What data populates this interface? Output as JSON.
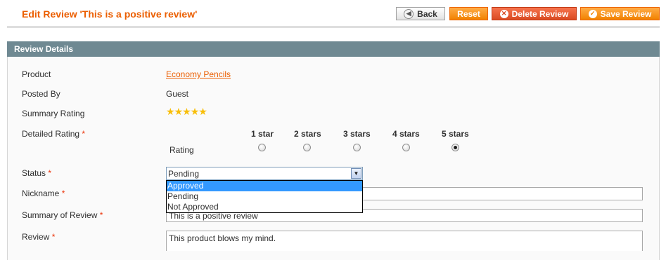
{
  "header": {
    "title": "Edit Review 'This is a positive review'",
    "buttons": {
      "back": "Back",
      "reset": "Reset",
      "delete": "Delete Review",
      "save": "Save Review"
    }
  },
  "section": {
    "title": "Review Details"
  },
  "form": {
    "product": {
      "label": "Product",
      "value": "Economy Pencils"
    },
    "posted_by": {
      "label": "Posted By",
      "value": "Guest"
    },
    "summary_rating": {
      "label": "Summary Rating",
      "stars": 5
    },
    "detailed_rating": {
      "label": "Detailed Rating",
      "required_mark": "*",
      "row_label": "Rating",
      "columns": [
        "1 star",
        "2 stars",
        "3 stars",
        "4 stars",
        "5 stars"
      ],
      "selected_index": 4
    },
    "status": {
      "label": "Status",
      "required_mark": "*",
      "value": "Pending",
      "options": [
        "Approved",
        "Pending",
        "Not Approved"
      ],
      "highlighted_option": "Approved"
    },
    "nickname": {
      "label": "Nickname",
      "required_mark": "*",
      "value": ""
    },
    "summary_of_review": {
      "label": "Summary of Review",
      "required_mark": "*",
      "value": "This is a positive review"
    },
    "review": {
      "label": "Review",
      "required_mark": "*",
      "value": "This product blows my mind."
    }
  },
  "colors": {
    "title": "#eb5e00",
    "section_header_bg": "#6f8992",
    "required": "#eb340a",
    "star": "#f8be08",
    "option_highlight": "#3399ff"
  },
  "icons": {
    "back": "arrow-left-icon",
    "delete": "delete-x-icon",
    "save": "checkmark-icon",
    "select": "chevron-down-icon",
    "star": "star-icon"
  }
}
